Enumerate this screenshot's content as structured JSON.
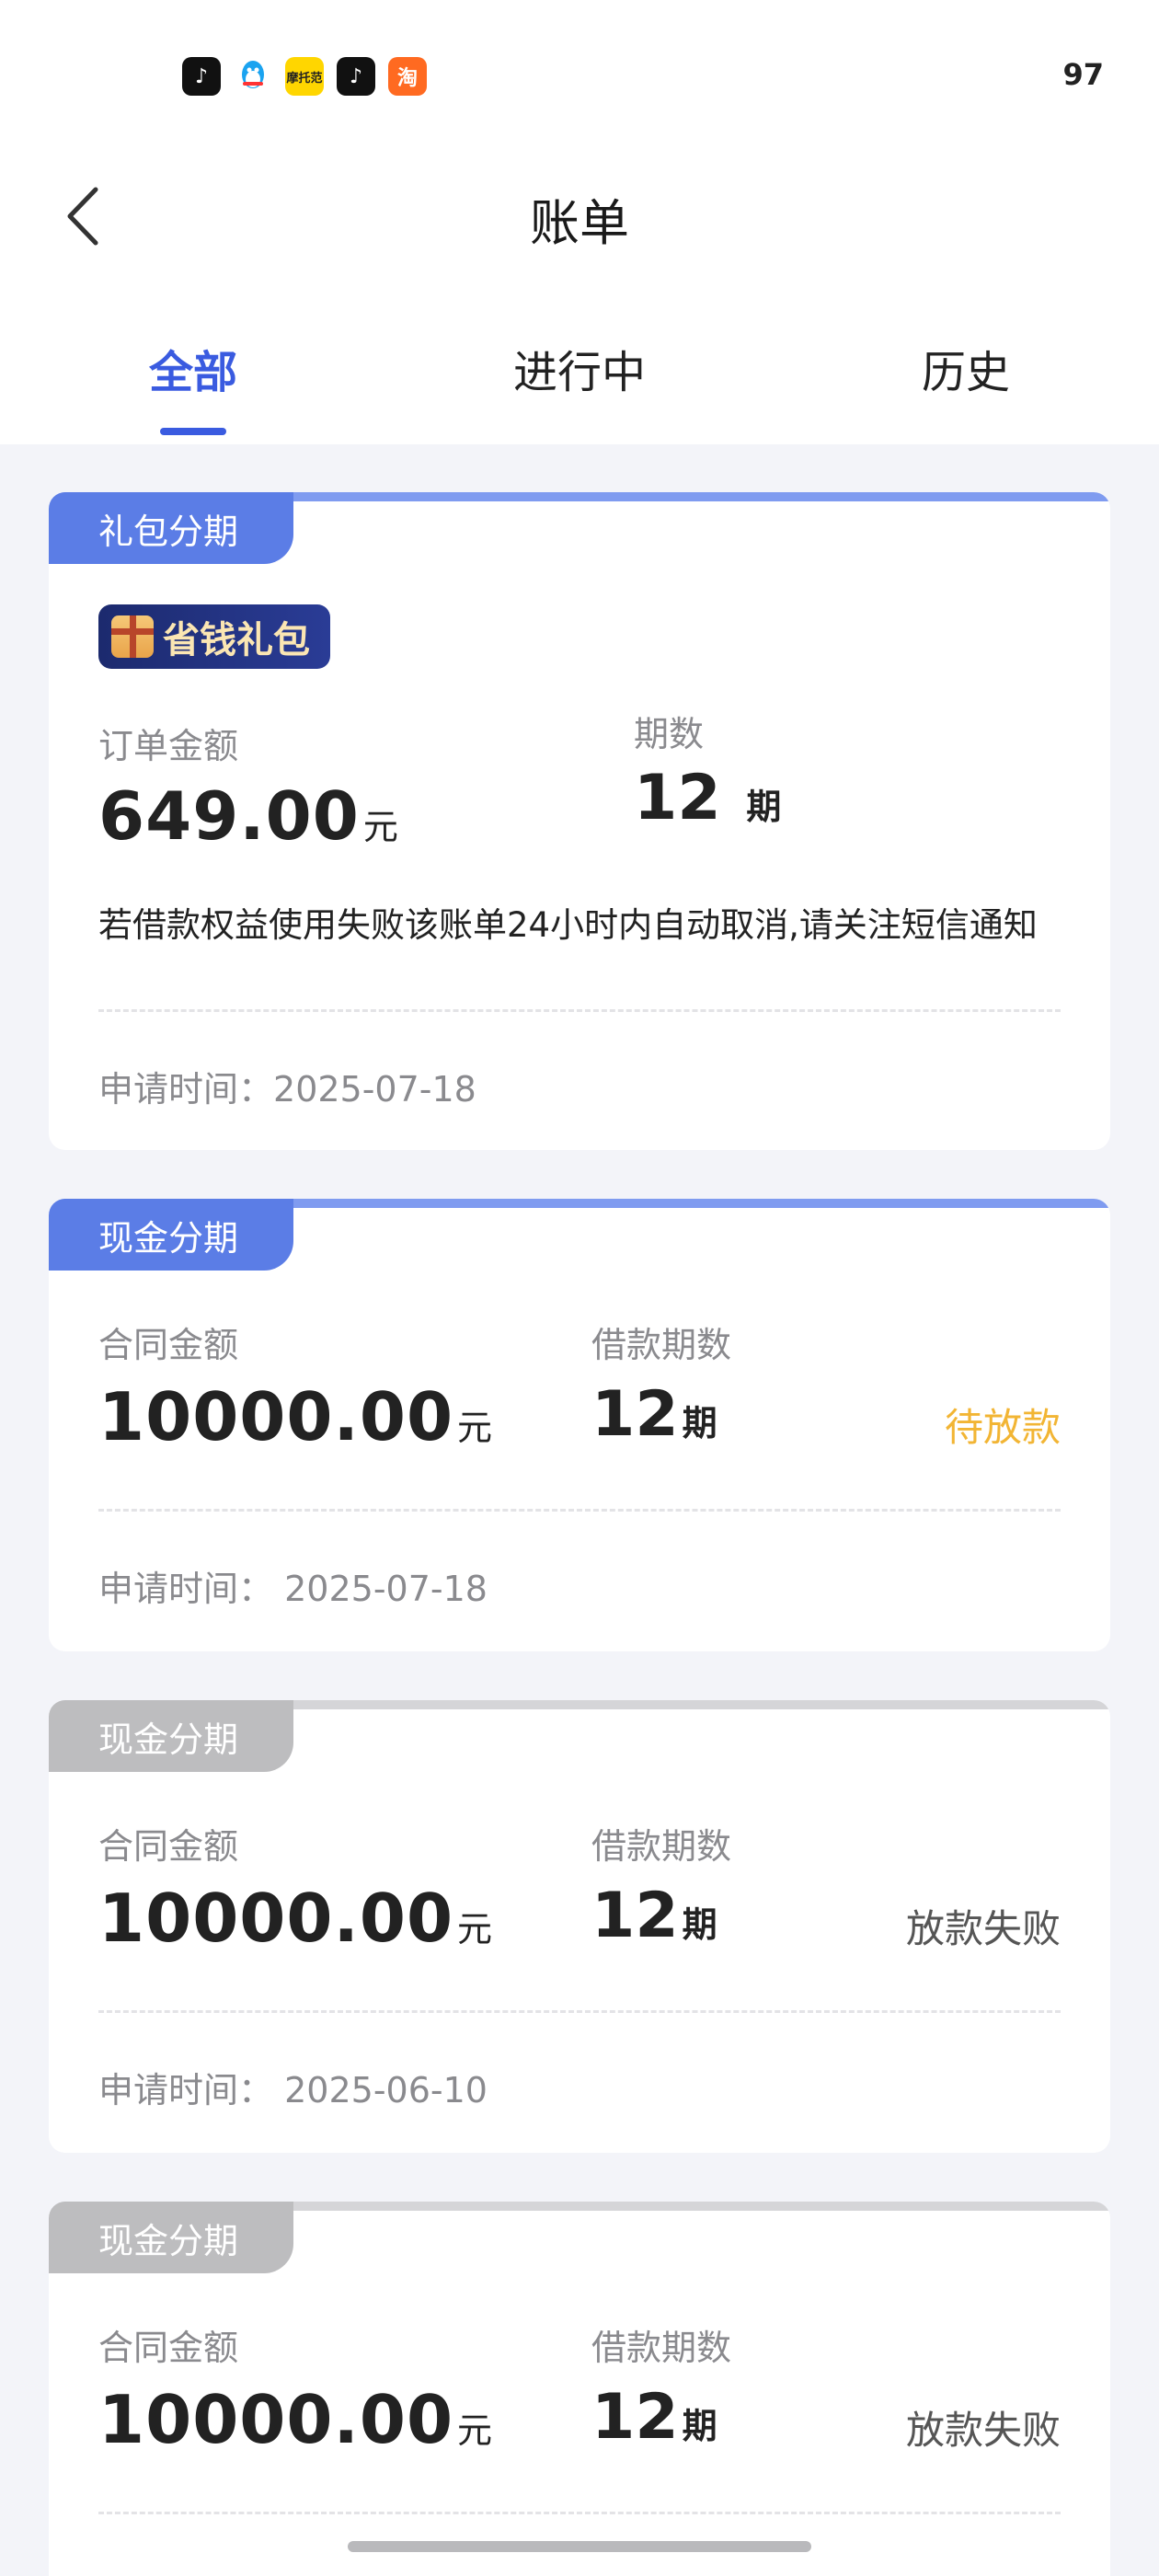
{
  "status_bar": {
    "battery": "97",
    "apps": [
      "tiktok-icon",
      "qq-icon",
      "yellow-app-icon",
      "tiktok-icon",
      "taobao-icon"
    ],
    "yellow_app_text": "摩托范",
    "taobao_text": "淘"
  },
  "header": {
    "title": "账单"
  },
  "tabs": [
    {
      "label": "全部",
      "active": true
    },
    {
      "label": "进行中",
      "active": false
    },
    {
      "label": "历史",
      "active": false
    }
  ],
  "cards": [
    {
      "type": "礼包分期",
      "gift_tag": "省钱礼包",
      "amount_label": "订单金额",
      "amount": "649.00",
      "amount_unit": "元",
      "period_label": "期数",
      "period": "12",
      "period_unit": "期",
      "note": "若借款权益使用失败该账单24小时内自动取消,请关注短信通知",
      "apply_label": "申请时间：",
      "apply_date": "2025-07-18"
    },
    {
      "type": "现金分期",
      "amount_label": "合同金额",
      "amount": "10000.00",
      "amount_unit": "元",
      "period_label": "借款期数",
      "period": "12",
      "period_unit": "期",
      "status": "待放款",
      "apply_label": "申请时间：",
      "apply_date": "2025-07-18"
    },
    {
      "type": "现金分期",
      "amount_label": "合同金额",
      "amount": "10000.00",
      "amount_unit": "元",
      "period_label": "借款期数",
      "period": "12",
      "period_unit": "期",
      "status": "放款失败",
      "apply_label": "申请时间：",
      "apply_date": "2025-06-10"
    },
    {
      "type": "现金分期",
      "amount_label": "合同金额",
      "amount": "10000.00",
      "amount_unit": "元",
      "period_label": "借款期数",
      "period": "12",
      "period_unit": "期",
      "status": "放款失败"
    }
  ],
  "colors": {
    "accent": "#3a5be0",
    "badge_active": "#5b7de6",
    "badge_inactive": "#bdbdbf",
    "pending": "#f2b534"
  }
}
